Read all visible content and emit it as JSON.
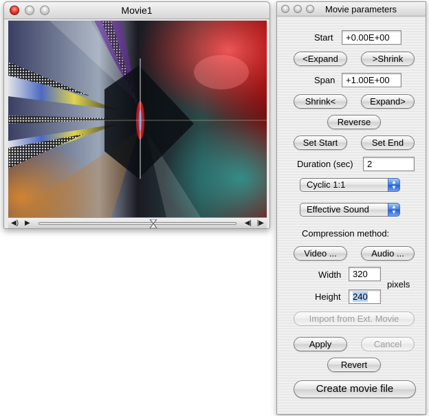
{
  "movie_window": {
    "title": "Movie1"
  },
  "params_window": {
    "title": "Movie parameters",
    "start": {
      "label": "Start",
      "value": "+0.00E+00"
    },
    "expand_left_label": "<Expand",
    "shrink_right_label": ">Shrink",
    "span": {
      "label": "Span",
      "value": "+1.00E+00"
    },
    "shrink_left_label": "Shrink<",
    "expand_right_label": "Expand>",
    "reverse_label": "Reverse",
    "set_start_label": "Set Start",
    "set_end_label": "Set End",
    "duration": {
      "label": "Duration (sec)",
      "value": "2"
    },
    "mode_popup": {
      "selected": "Cyclic 1:1"
    },
    "sound_popup": {
      "selected": "Effective Sound"
    },
    "compression_label": "Compression method:",
    "video_button_label": "Video ...",
    "audio_button_label": "Audio ...",
    "width": {
      "label": "Width",
      "value": "320"
    },
    "height": {
      "label": "Height",
      "value": "240"
    },
    "pixels_label": "pixels",
    "import_label": "Import from Ext. Movie",
    "apply_label": "Apply",
    "cancel_label": "Cancel",
    "revert_label": "Revert",
    "create_label": "Create movie file"
  },
  "icons": {
    "volume": "volume-icon",
    "play": "play-icon",
    "step_back": "step-back-icon",
    "step_forward": "step-forward-icon"
  },
  "colors": {
    "close_light": "#e0312a",
    "popup_stepper": "#3d7ae0"
  }
}
